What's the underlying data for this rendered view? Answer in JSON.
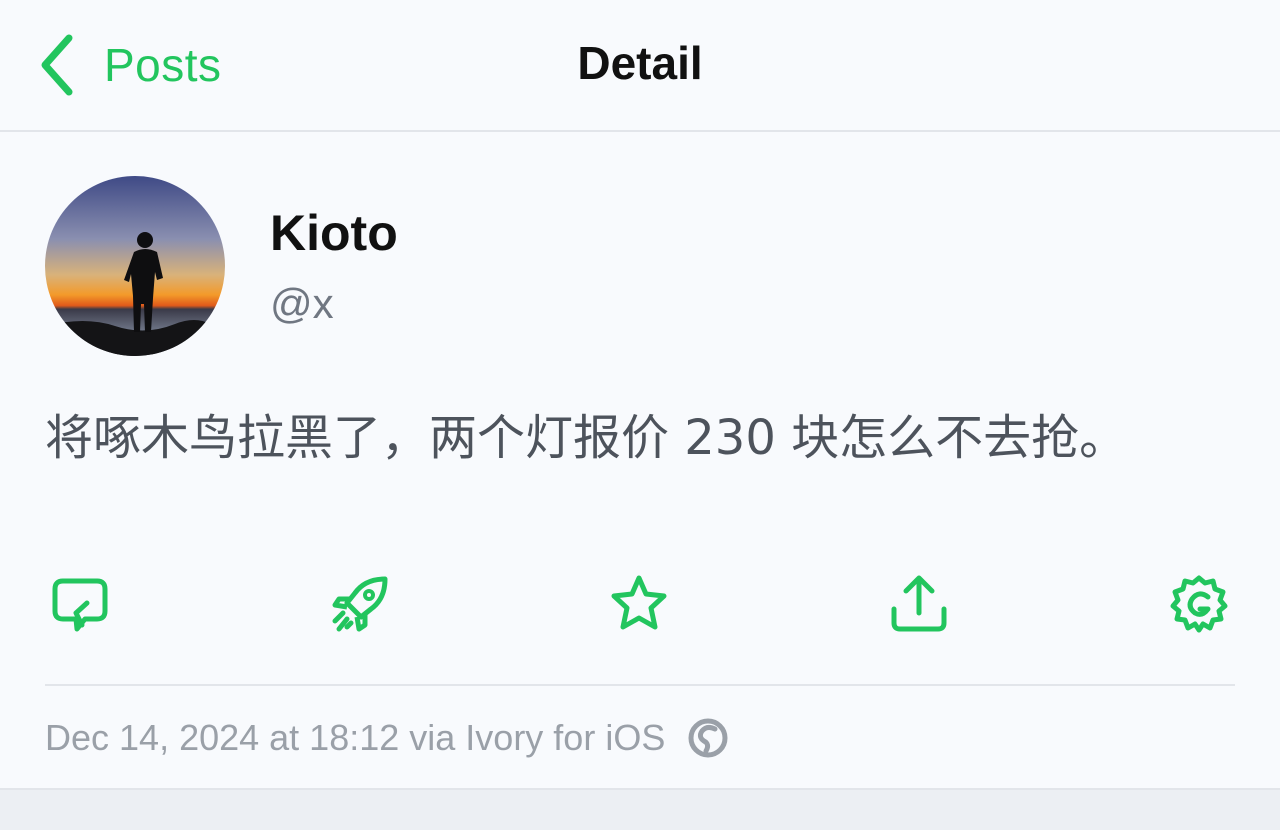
{
  "nav": {
    "back_label": "Posts",
    "title": "Detail"
  },
  "author": {
    "display_name": "Kioto",
    "handle": "@x",
    "avatar": "sunset-silhouette-avatar"
  },
  "post": {
    "text": "将啄木鸟拉黑了，两个灯报价 230 块怎么不去抢。"
  },
  "actions": [
    {
      "name": "reply",
      "icon": "reply-icon"
    },
    {
      "name": "boost",
      "icon": "rocket-icon"
    },
    {
      "name": "favorite",
      "icon": "star-icon"
    },
    {
      "name": "share",
      "icon": "share-icon"
    },
    {
      "name": "more",
      "icon": "gear-icon"
    }
  ],
  "meta": {
    "timestamp_line": "Dec 14, 2024 at 18:12 via Ivory for iOS",
    "client_icon": "ivory-app-icon"
  },
  "colors": {
    "accent": "#22c55e",
    "text_primary": "#111111",
    "text_secondary": "#707782",
    "post_text": "#4d535c",
    "meta_text": "#9aa0a8",
    "background": "#f8fafd"
  }
}
